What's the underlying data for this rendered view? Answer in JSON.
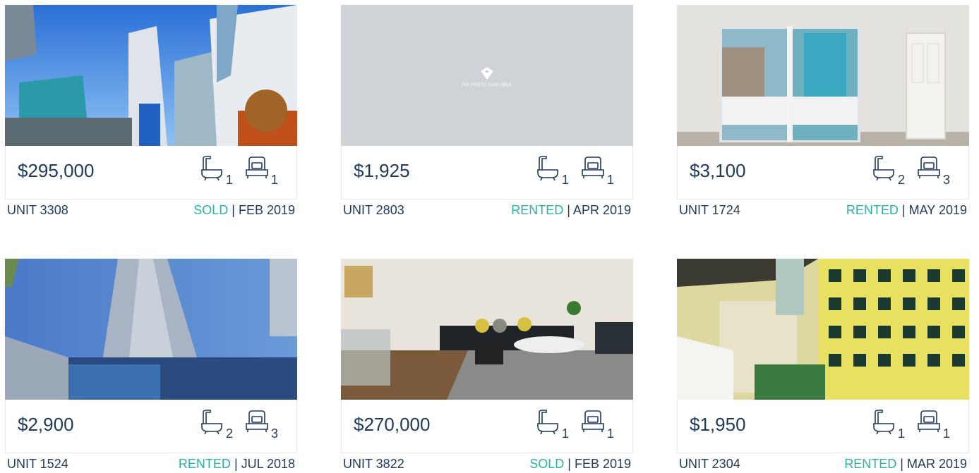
{
  "listings": [
    {
      "price": "$295,000",
      "baths": "1",
      "beds": "1",
      "unit": "UNIT 3308",
      "status": "SOLD",
      "date": "| FEB 2019",
      "photo": "tall-towers-blue-sky"
    },
    {
      "price": "$1,925",
      "baths": "1",
      "beds": "1",
      "unit": "UNIT 2803",
      "status": "RENTED",
      "date": "| APR 2019",
      "photo": "no-photo",
      "photo_text": "NO PHOTO AVAILABLE"
    },
    {
      "price": "$3,100",
      "baths": "2",
      "beds": "3",
      "unit": "UNIT 1724",
      "status": "RENTED",
      "date": "| MAY 2019",
      "photo": "empty-room-balcony-door"
    },
    {
      "price": "$2,900",
      "baths": "2",
      "beds": "3",
      "unit": "UNIT 1524",
      "status": "RENTED",
      "date": "| JUL 2018",
      "photo": "glass-tower-from-below"
    },
    {
      "price": "$270,000",
      "baths": "1",
      "beds": "1",
      "unit": "UNIT 3822",
      "status": "SOLD",
      "date": "| FEB 2019",
      "photo": "living-room-sofa"
    },
    {
      "price": "$1,950",
      "baths": "1",
      "beds": "1",
      "unit": "UNIT 2304",
      "status": "RENTED",
      "date": "| MAR 2019",
      "photo": "balcony-city-view"
    }
  ],
  "icons": {
    "bath": "bathtub-icon",
    "bed": "bed-icon"
  },
  "colors": {
    "text": "#1f3a5a",
    "status": "#2bb3a3",
    "border": "#e6e9ec"
  }
}
